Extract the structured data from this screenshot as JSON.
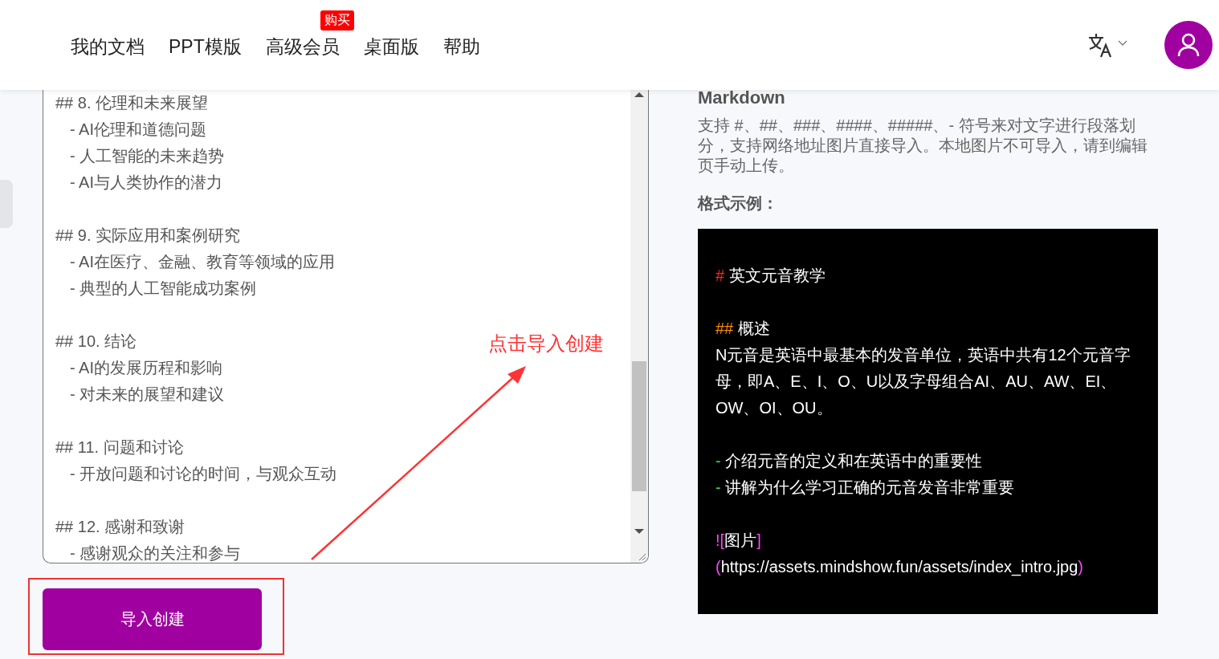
{
  "nav": {
    "items": [
      {
        "label": "我的文档"
      },
      {
        "label": "PPT模版"
      },
      {
        "label": "高级会员",
        "badge": "购买"
      },
      {
        "label": "桌面版"
      },
      {
        "label": "帮助"
      }
    ]
  },
  "editor": {
    "sections": [
      {
        "heading": "## 8. 伦理和未来展望",
        "items": [
          "- AI伦理和道德问题",
          "- 人工智能的未来趋势",
          "- AI与人类协作的潜力"
        ]
      },
      {
        "heading": "## 9. 实际应用和案例研究",
        "items": [
          "- AI在医疗、金融、教育等领域的应用",
          "- 典型的人工智能成功案例"
        ]
      },
      {
        "heading": "## 10. 结论",
        "items": [
          "- AI的发展历程和影响",
          "- 对未来的展望和建议"
        ]
      },
      {
        "heading": "## 11. 问题和讨论",
        "items": [
          "- 开放问题和讨论的时间，与观众互动"
        ]
      },
      {
        "heading": "## 12. 感谢和致谢",
        "items": [
          "- 感谢观众的关注和参与"
        ]
      }
    ]
  },
  "import_button": "导入创建",
  "annotation": "点击导入创建",
  "help": {
    "title": "Markdown",
    "description": "支持 #、##、###、####、#####、- 符号来对文字进行段落划分，支持网络地址图片直接导入。本地图片不可导入，请到编辑页手动上传。",
    "example_label": "格式示例：",
    "example": [
      [
        [
          {
            "text": "#",
            "color": "#ff2020"
          },
          {
            "text": " 英文元音教学"
          }
        ]
      ],
      [
        [
          {
            "text": "##",
            "color": "#ff8c00"
          },
          {
            "text": " 概述"
          }
        ],
        [
          {
            "text": " N元音是英语中最基本的发音单位，英语中共有12个元音字母，即A、E、I、O、U以及字母组合AI、AU、AW、EI、OW、OI、OU。"
          }
        ]
      ],
      [
        [
          {
            "text": "-",
            "color": "#33dd55"
          },
          {
            "text": " 介绍元音的定义和在英语中的重要性"
          }
        ],
        [
          {
            "text": "-",
            "color": "#33dd55"
          },
          {
            "text": " 讲解为什么学习正确的元音发音非常重要"
          }
        ]
      ],
      [
        [
          {
            "text": "!",
            "color": "#ff44ff"
          },
          {
            "text": "[",
            "color": "#ff44ff"
          },
          {
            "text": "图片"
          },
          {
            "text": "]",
            "color": "#ff44ff"
          }
        ],
        [
          {
            "text": "(",
            "color": "#ff44ff"
          },
          {
            "text": "https://assets.mindshow.fun/assets/index_intro.jpg"
          },
          {
            "text": ")",
            "color": "#ff44ff"
          }
        ]
      ]
    ]
  }
}
